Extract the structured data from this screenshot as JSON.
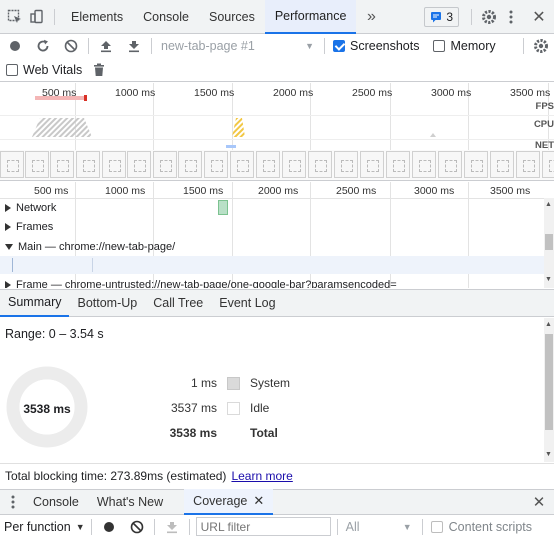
{
  "toolbar": {
    "tabs": [
      {
        "label": "Elements"
      },
      {
        "label": "Console"
      },
      {
        "label": "Sources"
      },
      {
        "label": "Performance",
        "active": true
      }
    ],
    "issues_count": "3"
  },
  "perf_toolbar": {
    "profile_select": "new-tab-page #1",
    "screenshots_label": "Screenshots",
    "memory_label": "Memory",
    "web_vitals_label": "Web Vitals"
  },
  "overview": {
    "ruler": [
      "500 ms",
      "1000 ms",
      "1500 ms",
      "2000 ms",
      "2500 ms",
      "3000 ms",
      "3500 ms"
    ],
    "fps_label": "FPS",
    "cpu_label": "CPU",
    "net_label": "NET"
  },
  "timeline": {
    "ruler": [
      "500 ms",
      "1000 ms",
      "1500 ms",
      "2000 ms",
      "2500 ms",
      "3000 ms",
      "3500 ms"
    ],
    "tracks": [
      {
        "label": "Network",
        "expanded": false
      },
      {
        "label": "Frames",
        "expanded": false
      },
      {
        "label": "Main — chrome://new-tab-page/",
        "expanded": true
      },
      {
        "label": "Frame — chrome-untrusted://new-tab-page/one-google-bar?paramsencoded=",
        "expanded": false
      }
    ]
  },
  "details": {
    "tabs": [
      {
        "label": "Summary",
        "active": true
      },
      {
        "label": "Bottom-Up"
      },
      {
        "label": "Call Tree"
      },
      {
        "label": "Event Log"
      }
    ],
    "range": "Range: 0 – 3.54 s",
    "donut_total": "3538 ms",
    "rows": [
      {
        "value": "1 ms",
        "name": "System",
        "color": "#dadada"
      },
      {
        "value": "3537 ms",
        "name": "Idle",
        "color": "#ffffff"
      },
      {
        "value": "3538 ms",
        "name": "Total",
        "bold": true
      }
    ],
    "blocking": "Total blocking time: 273.89ms (estimated)",
    "learn_more": "Learn more"
  },
  "drawer": {
    "tabs": [
      {
        "label": "Console"
      },
      {
        "label": "What's New"
      },
      {
        "label": "Coverage",
        "active": true
      }
    ],
    "per_function": "Per function",
    "url_filter_placeholder": "URL filter",
    "all_select": "All",
    "content_scripts_label": "Content scripts"
  },
  "colors": {
    "accent": "#1a73e8",
    "fps_bar": "#f4b6b6",
    "fps_red": "#d93025",
    "cpu_scripting": "#f2c744",
    "cpu_idle": "#d9d9d9"
  }
}
